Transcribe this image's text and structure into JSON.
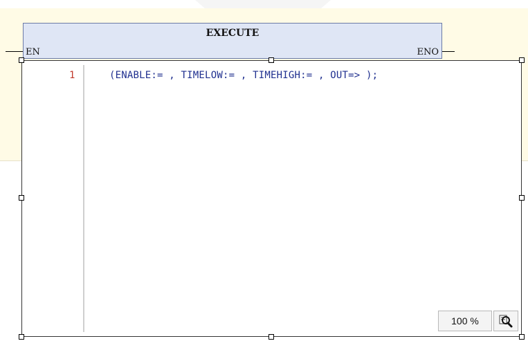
{
  "function_block": {
    "title": "EXECUTE",
    "pin_in": "EN",
    "pin_out": "ENO"
  },
  "editor": {
    "line_number": "1",
    "code": "(ENABLE:= , TIMELOW:= , TIMEHIGH:= , OUT=> );"
  },
  "zoom": {
    "level": "100 %",
    "button_icon": "zoom-magnifier-icon"
  }
}
